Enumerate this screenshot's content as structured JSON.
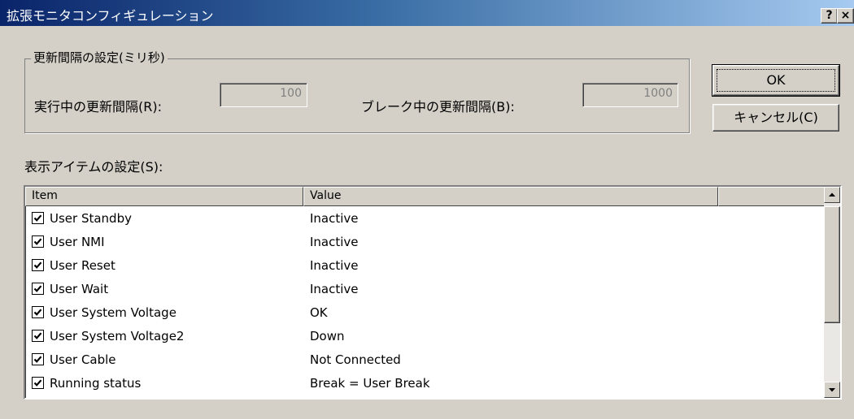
{
  "window": {
    "title": "拡張モニタコンフィギュレーション",
    "help_label": "?",
    "close_label": "×"
  },
  "update_group": {
    "legend": "更新間隔の設定(ミリ秒)",
    "running_label": "実行中の更新間隔(R):",
    "running_value": "100",
    "break_label": "ブレーク中の更新間隔(B):",
    "break_value": "1000"
  },
  "buttons": {
    "ok_label": "OK",
    "cancel_label": "キャンセル(C)"
  },
  "items_section": {
    "label": "表示アイテムの設定(S):",
    "columns": [
      "Item",
      "Value",
      ""
    ],
    "rows": [
      {
        "item": "User Standby",
        "value": "Inactive",
        "checked": true
      },
      {
        "item": "User NMI",
        "value": "Inactive",
        "checked": true
      },
      {
        "item": "User Reset",
        "value": "Inactive",
        "checked": true
      },
      {
        "item": "User Wait",
        "value": "Inactive",
        "checked": true
      },
      {
        "item": "User System Voltage",
        "value": "OK",
        "checked": true
      },
      {
        "item": "User System Voltage2",
        "value": "Down",
        "checked": true
      },
      {
        "item": "User Cable",
        "value": "Not Connected",
        "checked": true
      },
      {
        "item": "Running status",
        "value": "Break = User Break",
        "checked": true
      }
    ]
  },
  "icons": {
    "checkbox": "check-icon",
    "scroll_up": "up-arrow-icon",
    "scroll_down": "down-arrow-icon"
  }
}
